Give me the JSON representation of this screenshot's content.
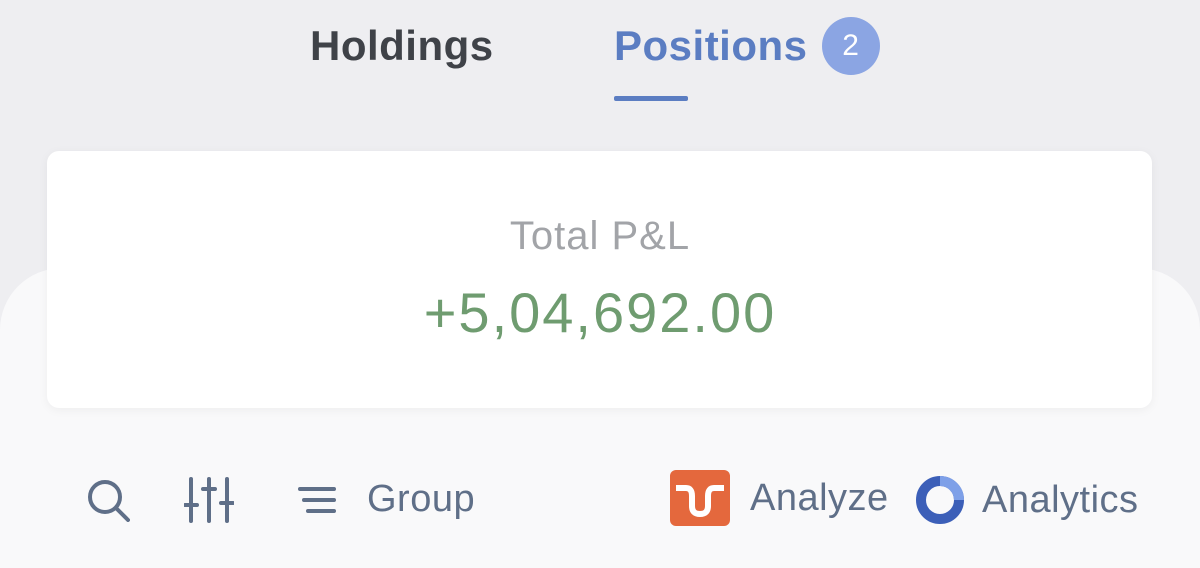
{
  "tabs": {
    "holdings": {
      "label": "Holdings"
    },
    "positions": {
      "label": "Positions",
      "count": "2"
    },
    "active": "positions"
  },
  "summary": {
    "label": "Total P&L",
    "value": "+5,04,692.00"
  },
  "toolbar": {
    "search_icon": "search-icon",
    "filter_icon": "sliders-icon",
    "group": {
      "icon": "list-icon",
      "label": "Group"
    },
    "analyze": {
      "icon": "analyze-logo-icon",
      "label": "Analyze"
    },
    "analytics": {
      "icon": "analytics-logo-icon",
      "label": "Analytics"
    }
  },
  "colors": {
    "accent": "#5b7dc2",
    "badge": "#8ba5e3",
    "profit": "#6f9c70",
    "analyze_brand": "#e4683d",
    "analytics_brand": "#3c5fb8"
  }
}
